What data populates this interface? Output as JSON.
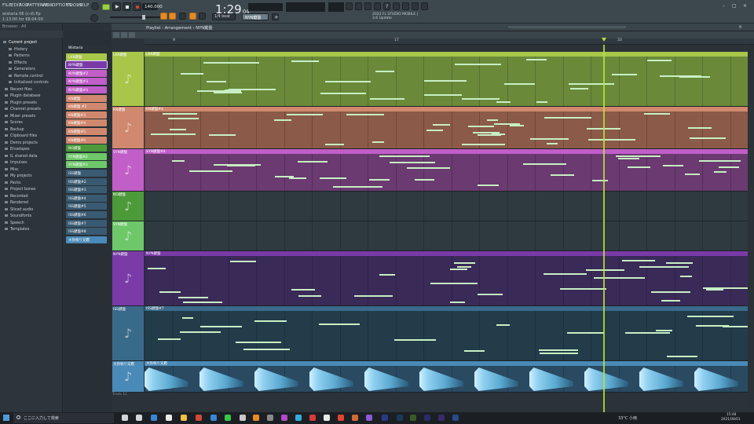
{
  "menu": [
    "FILE",
    "EDIT",
    "ADD",
    "PATTERNS",
    "VIEW",
    "OPTIONS",
    "TOOLS",
    "HELP"
  ],
  "project": {
    "file": "wistaria 06 (c-d).flp",
    "time": "1:13:00 for 68:04:00"
  },
  "transport": {
    "bpm": "140.000",
    "time": "1:29",
    "ticks": "04",
    "pattern": "NYN鍵盤",
    "snap": "1/4 beat"
  },
  "news": {
    "line1": "2022 FL STUDIO MOBILE |",
    "line2": "3.6 Update"
  },
  "playlist": {
    "breadcrumb": "Playlist - Arrangement › NYN鍵盤",
    "markers": [
      "9",
      "17",
      "33"
    ]
  },
  "browser": {
    "title": "Browser - All",
    "items": [
      "Current project",
      "History",
      "Patterns",
      "Effects",
      "Generators",
      "Remote control",
      "Initialized controls",
      "Recent files",
      "Plugin database",
      "Plugin presets",
      "Channel presets",
      "Mixer presets",
      "Scores",
      "Backup",
      "Clipboard files",
      "Demo projects",
      "Envelopes",
      "IL shared data",
      "Impulses",
      "Misc",
      "My projects",
      "Packs",
      "Project bones",
      "Recorded",
      "Rendered",
      "Sliced audio",
      "Soundfonts",
      "Speech",
      "Templates"
    ]
  },
  "patterns": [
    "Wistaria",
    "LKK鍵盤",
    "NYN鍵盤",
    "NYN鍵盤#2",
    "NYN鍵盤#3",
    "NYN鍵盤#4",
    "KN鍵盤",
    "KN鍵盤 #2",
    "KN鍵盤#3",
    "KN鍵盤#4",
    "KN鍵盤#5",
    "KN鍵盤#6",
    "NO鍵盤",
    "SYN鍵盤#2",
    "SYN鍵盤#3",
    "ISS鍵盤",
    "ISS鍵盤#2",
    "ISS鍵盤#3",
    "ISS鍵盤#4",
    "ISS鍵盤#5",
    "ISS鍵盤#6",
    "ISS鍵盤#7",
    "ISS鍵盤#8",
    "大弥祝り兄鷹"
  ],
  "tracks": [
    {
      "name": "LKK鍵盤",
      "clip": "LKK鍵盤",
      "color": "#a8c74a",
      "bg": "#6a8a3a"
    },
    {
      "name": "KN鍵盤",
      "clip": "KN鍵盤#4",
      "color": "#d0886e",
      "bg": "#8b5a48"
    },
    {
      "name": "SYN鍵盤",
      "clip": "SYN鍵盤#4",
      "color": "#c15ec8",
      "bg": "#6a3a70"
    },
    {
      "name": "NO鍵盤",
      "clip": "",
      "color": "#4c9a3a",
      "bg": "#2e3a3f"
    },
    {
      "name": "SYN鍵盤",
      "clip": "",
      "color": "#6ec86a",
      "bg": "#2e3a3f"
    },
    {
      "name": "NYN鍵盤",
      "clip": "NYN鍵盤",
      "color": "#7a3aa8",
      "bg": "#3a2a58"
    },
    {
      "name": "ISS鍵盤",
      "clip": "ISS鍵盤#7",
      "color": "#3a6a8a",
      "bg": "#233c4a"
    },
    {
      "name": "大弥祝り兄鷹",
      "clip": "大弥祝り兄鷹",
      "color": "#4a8ab8",
      "bg": "#2a4a62"
    }
  ],
  "track_last": "Track 11",
  "taskbar": {
    "search": "ここに入力して検索",
    "weather": "33°C 小雨",
    "clock": "15:48",
    "date": "2021/08/01"
  }
}
